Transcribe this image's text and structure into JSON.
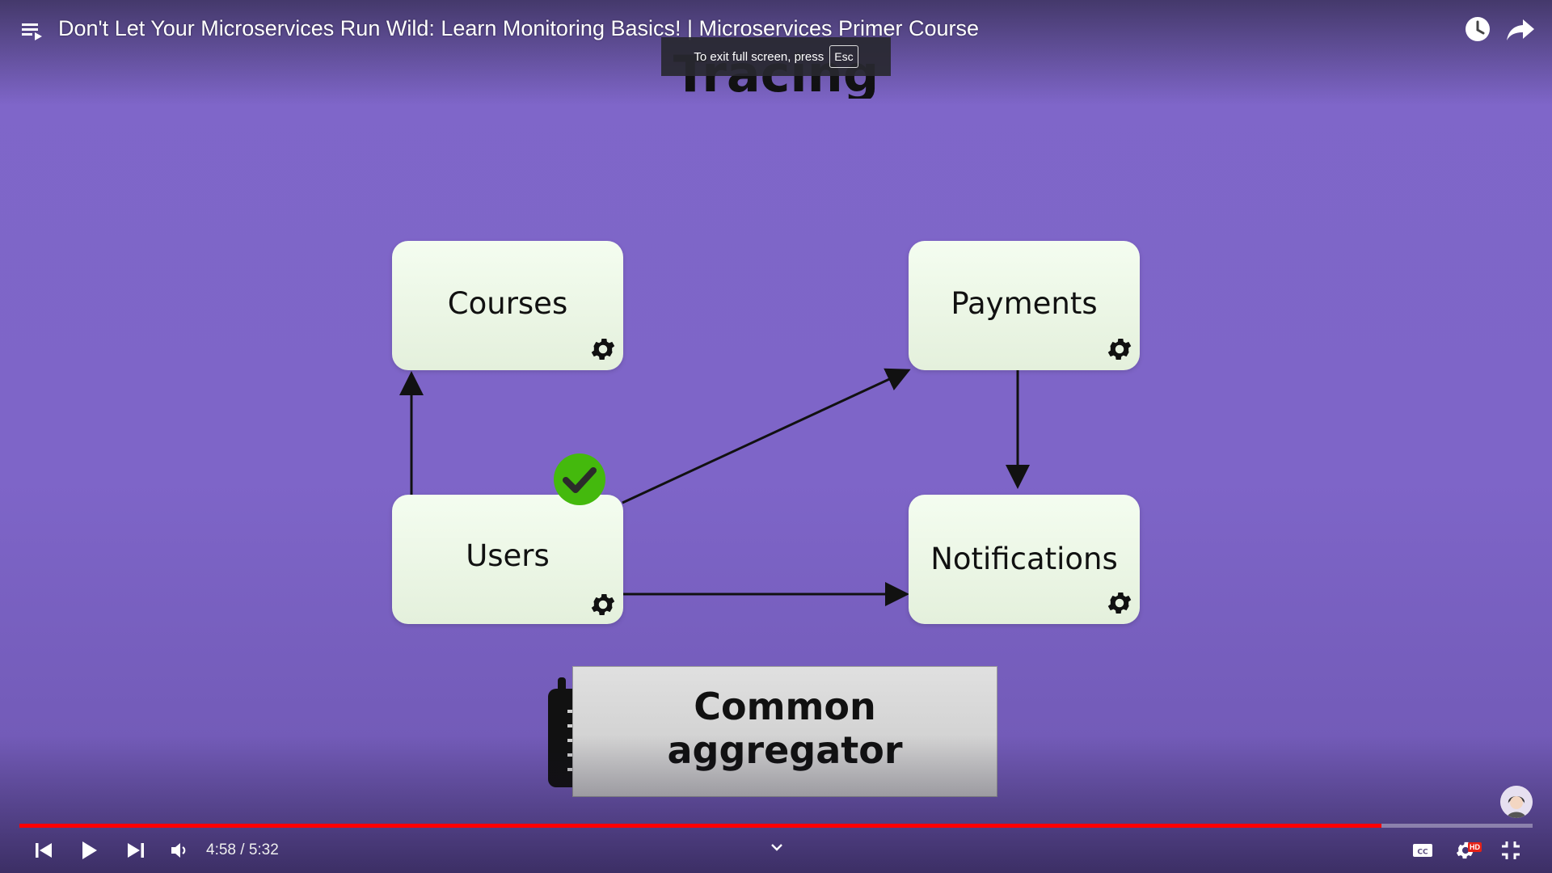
{
  "player": {
    "title": "Don't Let Your Microservices Run Wild: Learn Monitoring Basics! | Microservices Primer Course",
    "current_time": "4:58",
    "duration": "5:32",
    "time_display": "4:58 / 5:32",
    "progress": 0.9,
    "quality_badge": "HD",
    "fullscreen_toast": {
      "text": "To exit full screen, press",
      "key": "Esc"
    },
    "accent_color": "#ff0000"
  },
  "slide": {
    "heading": "Tracing",
    "background_color": "#7f66c9",
    "services": {
      "courses": "Courses",
      "payments": "Payments",
      "users": "Users",
      "notifications": "Notifications"
    },
    "aggregator": {
      "line1": "Common",
      "line2": "aggregator"
    },
    "check_color": "#44b90d"
  },
  "icons": {
    "playlist": "playlist-icon",
    "watch_later": "clock-icon",
    "share": "share-icon",
    "previous": "skip-previous-icon",
    "play": "play-icon",
    "next": "skip-next-icon",
    "volume": "volume-icon",
    "chevron": "chevron-down-icon",
    "captions": "captions-icon",
    "settings": "gear-icon",
    "fullscreen_exit": "fullscreen-exit-icon"
  }
}
